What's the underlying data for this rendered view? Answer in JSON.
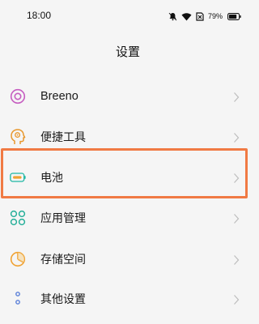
{
  "status_bar": {
    "time": "18:00",
    "battery_percent": "79%",
    "icons": [
      "alarm-bell-icon",
      "wifi-icon",
      "sim-off-icon",
      "battery-icon"
    ]
  },
  "header": {
    "title": "设置"
  },
  "menu": {
    "items": [
      {
        "label": "Breeno",
        "icon": "breeno-ring-icon"
      },
      {
        "label": "便捷工具",
        "icon": "head-gear-icon"
      },
      {
        "label": "电池",
        "icon": "battery-icon"
      },
      {
        "label": "应用管理",
        "icon": "app-grid-icon"
      },
      {
        "label": "存储空间",
        "icon": "pie-chart-icon"
      },
      {
        "label": "其他设置",
        "icon": "more-dots-icon"
      }
    ]
  },
  "colors": {
    "highlight": "#f07a44",
    "breeno": "#c65dc0",
    "tools": "#e8972d",
    "battery": "#1fb7a3",
    "apps": "#28b09a",
    "storage": "#f0a233",
    "more": "#5a7fd8"
  }
}
